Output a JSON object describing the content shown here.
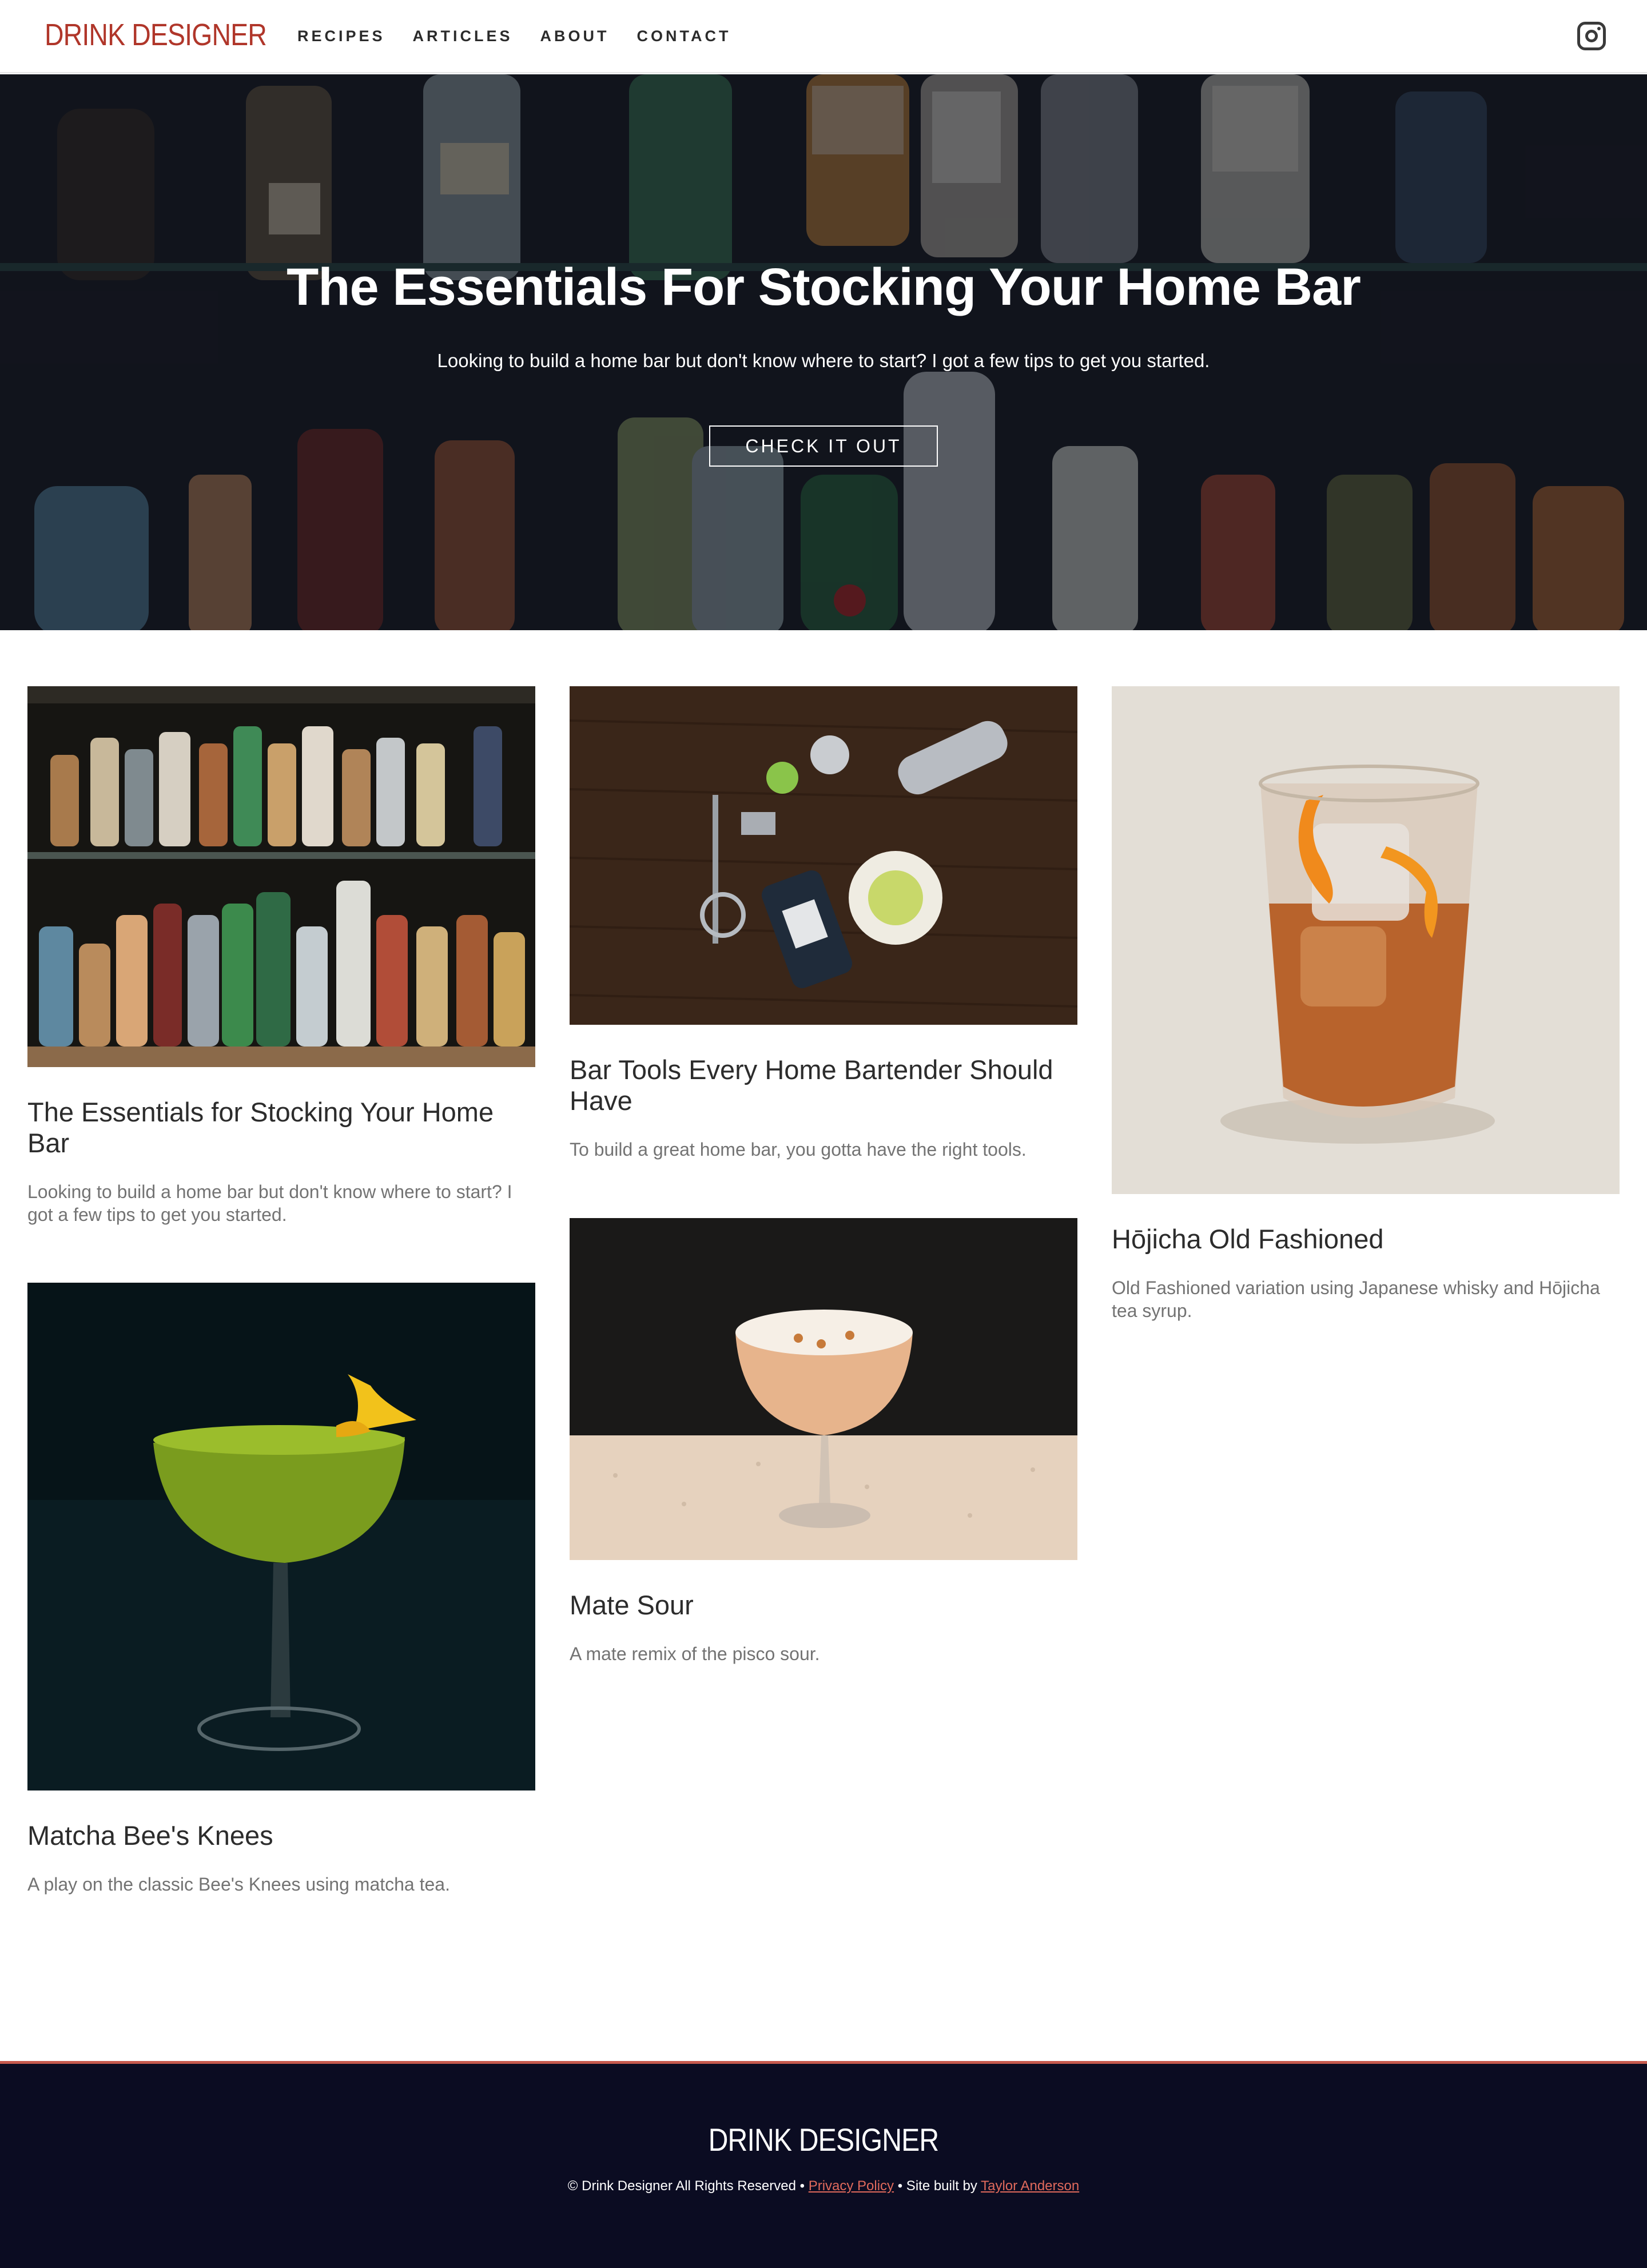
{
  "header": {
    "logo": "DRINK DESIGNER",
    "nav": [
      "RECIPES",
      "ARTICLES",
      "ABOUT",
      "CONTACT"
    ],
    "social_icon": "instagram-icon"
  },
  "hero": {
    "title": "The Essentials For Stocking Your Home Bar",
    "subtitle": "Looking to build a home bar but don't know where to start? I got a few tips to get you started.",
    "button": "CHECK IT OUT"
  },
  "cards": [
    {
      "title": "The Essentials for Stocking Your Home Bar",
      "desc": "Looking to build a home bar but don't know where to start? I got a few tips to get you started.",
      "image": "home-bar-shelves"
    },
    {
      "title": "Bar Tools Every Home Bartender Should Have",
      "desc": "To build a great home bar, you gotta have the right tools.",
      "image": "bar-tools-flatlay"
    },
    {
      "title": "Hōjicha Old Fashioned",
      "desc": "Old Fashioned variation using Japanese whisky and Hōjicha tea syrup.",
      "image": "old-fashioned-glass"
    },
    {
      "title": "Matcha Bee's Knees",
      "desc": "A play on the classic Bee's Knees using matcha tea.",
      "image": "matcha-coupe"
    },
    {
      "title": "Mate Sour",
      "desc": "A mate remix of the pisco sour.",
      "image": "mate-sour-coupe"
    }
  ],
  "footer": {
    "logo": "DRINK DESIGNER",
    "copyright": "© Drink Designer All Rights Reserved •",
    "privacy": "Privacy Policy",
    "built_by": "• Site built by",
    "author": "Taylor Anderson"
  },
  "colors": {
    "brand": "#b0362a",
    "footer_bg": "#0b0c22",
    "footer_accent": "#c75a4e",
    "link": "#e06a5c"
  }
}
